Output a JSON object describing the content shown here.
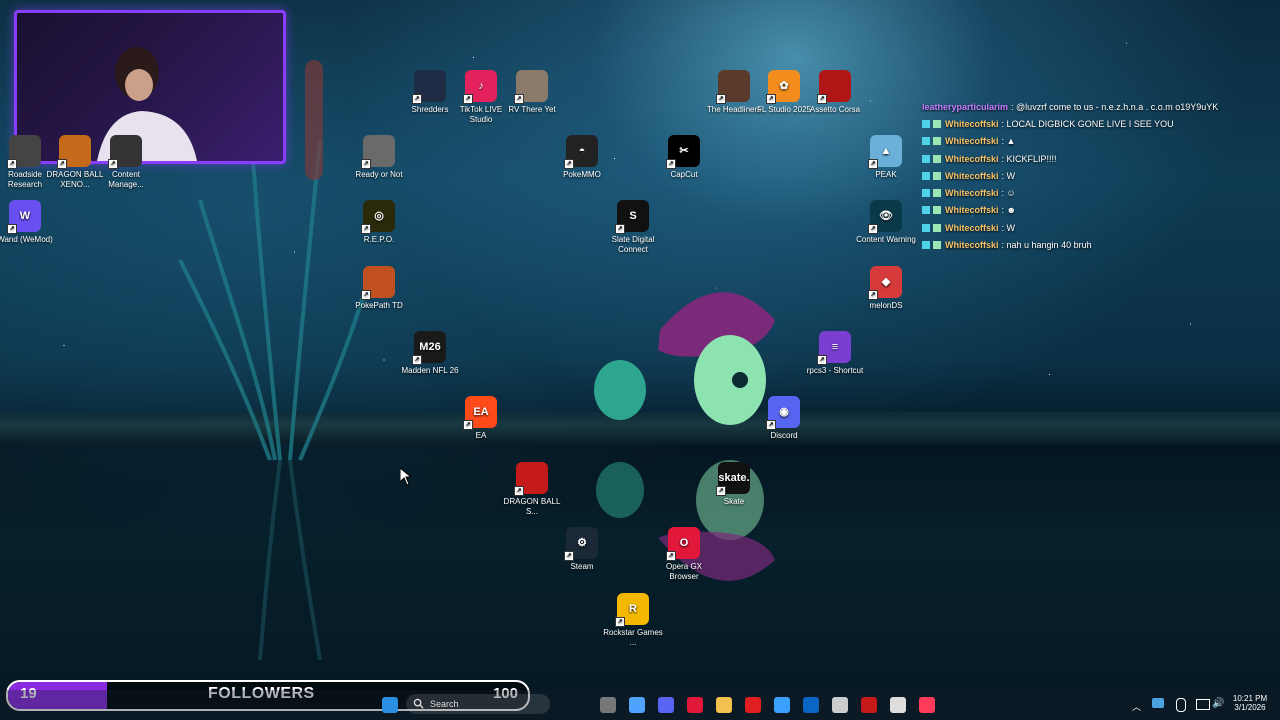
{
  "desktop_icons": [
    {
      "label": "Shredders",
      "color": "#1f2a44"
    },
    {
      "label": "TikTok LIVE Studio",
      "color": "#e2215d"
    },
    {
      "label": "RV There Yet",
      "color": "#8a7a6a"
    },
    {
      "label": "The Headliners",
      "color": "#5a3a2a"
    },
    {
      "label": "FL Studio 2025",
      "color": "#f28c1c"
    },
    {
      "label": "Assetto Corsa",
      "color": "#b01616"
    },
    {
      "label": "Ready or Not",
      "color": "#6a6a6a"
    },
    {
      "label": "PokeMMO",
      "color": "#222"
    },
    {
      "label": "CapCut",
      "color": "#000"
    },
    {
      "label": "PEAK",
      "color": "#6ab0d8"
    },
    {
      "label": "R.E.P.O.",
      "color": "#2a2a0a"
    },
    {
      "label": "Slate Digital Connect",
      "color": "#111"
    },
    {
      "label": "Content Warning",
      "color": "#0a3a4a"
    },
    {
      "label": "PokePath TD",
      "color": "#c05020"
    },
    {
      "label": "melonDS",
      "color": "#d63a3a"
    },
    {
      "label": "Madden NFL 26",
      "color": "#1a1a1a"
    },
    {
      "label": "rpcs3 - Shortcut",
      "color": "#7a3fd0"
    },
    {
      "label": "EA",
      "color": "#ff4b1a"
    },
    {
      "label": "Discord",
      "color": "#5865f2"
    },
    {
      "label": "DRAGON BALL S...",
      "color": "#c41a1a"
    },
    {
      "label": "Skate",
      "color": "#111"
    },
    {
      "label": "Steam",
      "color": "#1b2838"
    },
    {
      "label": "Opera GX Browser",
      "color": "#e1183a"
    },
    {
      "label": "Rockstar Games ...",
      "color": "#f5b800"
    },
    {
      "label": "Roadside Research",
      "color": "#444"
    },
    {
      "label": "DRAGON BALL XENO...",
      "color": "#c46a1a"
    },
    {
      "label": "Content Manage...",
      "color": "#333"
    },
    {
      "label": "Wand (WeMod)",
      "color": "#6a4ff0"
    }
  ],
  "icon_glyphs": {
    "PokeMMO": "◓",
    "CapCut": "✂",
    "Discord": "◉",
    "Steam": "⚙",
    "EA": "EA",
    "Skate": "skate.",
    "Madden NFL 26": "M26",
    "Rockstar Games ...": "R",
    "Opera GX Browser": "O",
    "Wand (WeMod)": "W",
    "rpcs3 - Shortcut": "≡",
    "Slate Digital Connect": "S",
    "R.E.P.O.": "◎",
    "Content Warning": "👁",
    "melonDS": "◆",
    "PEAK": "▲",
    "FL Studio 2025": "✿",
    "TikTok LIVE Studio": "♪"
  },
  "chat": [
    {
      "user": "leatheryparticularim",
      "msg": ": @luvzrf come to us - n.e.z.h.n.a . c.o.m o19Y9uYK",
      "user_color": "#c77dff"
    },
    {
      "user": "Whitecoffski",
      "msg": ": LOCAL DIGBICK GONE LIVE I SEE YOU",
      "user_color": "#f6c36a"
    },
    {
      "user": "Whitecoffski",
      "msg": ": ▲",
      "user_color": "#f6c36a"
    },
    {
      "user": "Whitecoffski",
      "msg": ": KICKFLIP!!!!",
      "user_color": "#f6c36a"
    },
    {
      "user": "Whitecoffski",
      "msg": ": W",
      "user_color": "#f6c36a"
    },
    {
      "user": "Whitecoffski",
      "msg": ": ☺",
      "user_color": "#f6c36a"
    },
    {
      "user": "Whitecoffski",
      "msg": ": ☻",
      "user_color": "#f6c36a"
    },
    {
      "user": "Whitecoffski",
      "msg": ": W",
      "user_color": "#f6c36a"
    },
    {
      "user": "Whitecoffski",
      "msg": ": nah u hangin 40 bruh",
      "user_color": "#f6c36a"
    }
  ],
  "followers": {
    "count": "19",
    "label": "FOLLOWERS",
    "goal": "100",
    "progress": 0.19
  },
  "taskbar": {
    "search_placeholder": "Search",
    "time": "10:21 PM",
    "date": "3/1/2026",
    "icons": [
      "windows-start-icon",
      "search-icon",
      "task-view-icon",
      "copilot-icon",
      "discord-icon",
      "opera-gx-icon",
      "file-explorer-icon",
      "red-app-icon",
      "help-icon",
      "outlook-icon",
      "settings-gear-icon",
      "red-square-app-icon",
      "chatgpt-icon",
      "music-icon"
    ]
  },
  "colors": {
    "accent": "#8a2be2",
    "webcam_border": "#8a3cff"
  }
}
